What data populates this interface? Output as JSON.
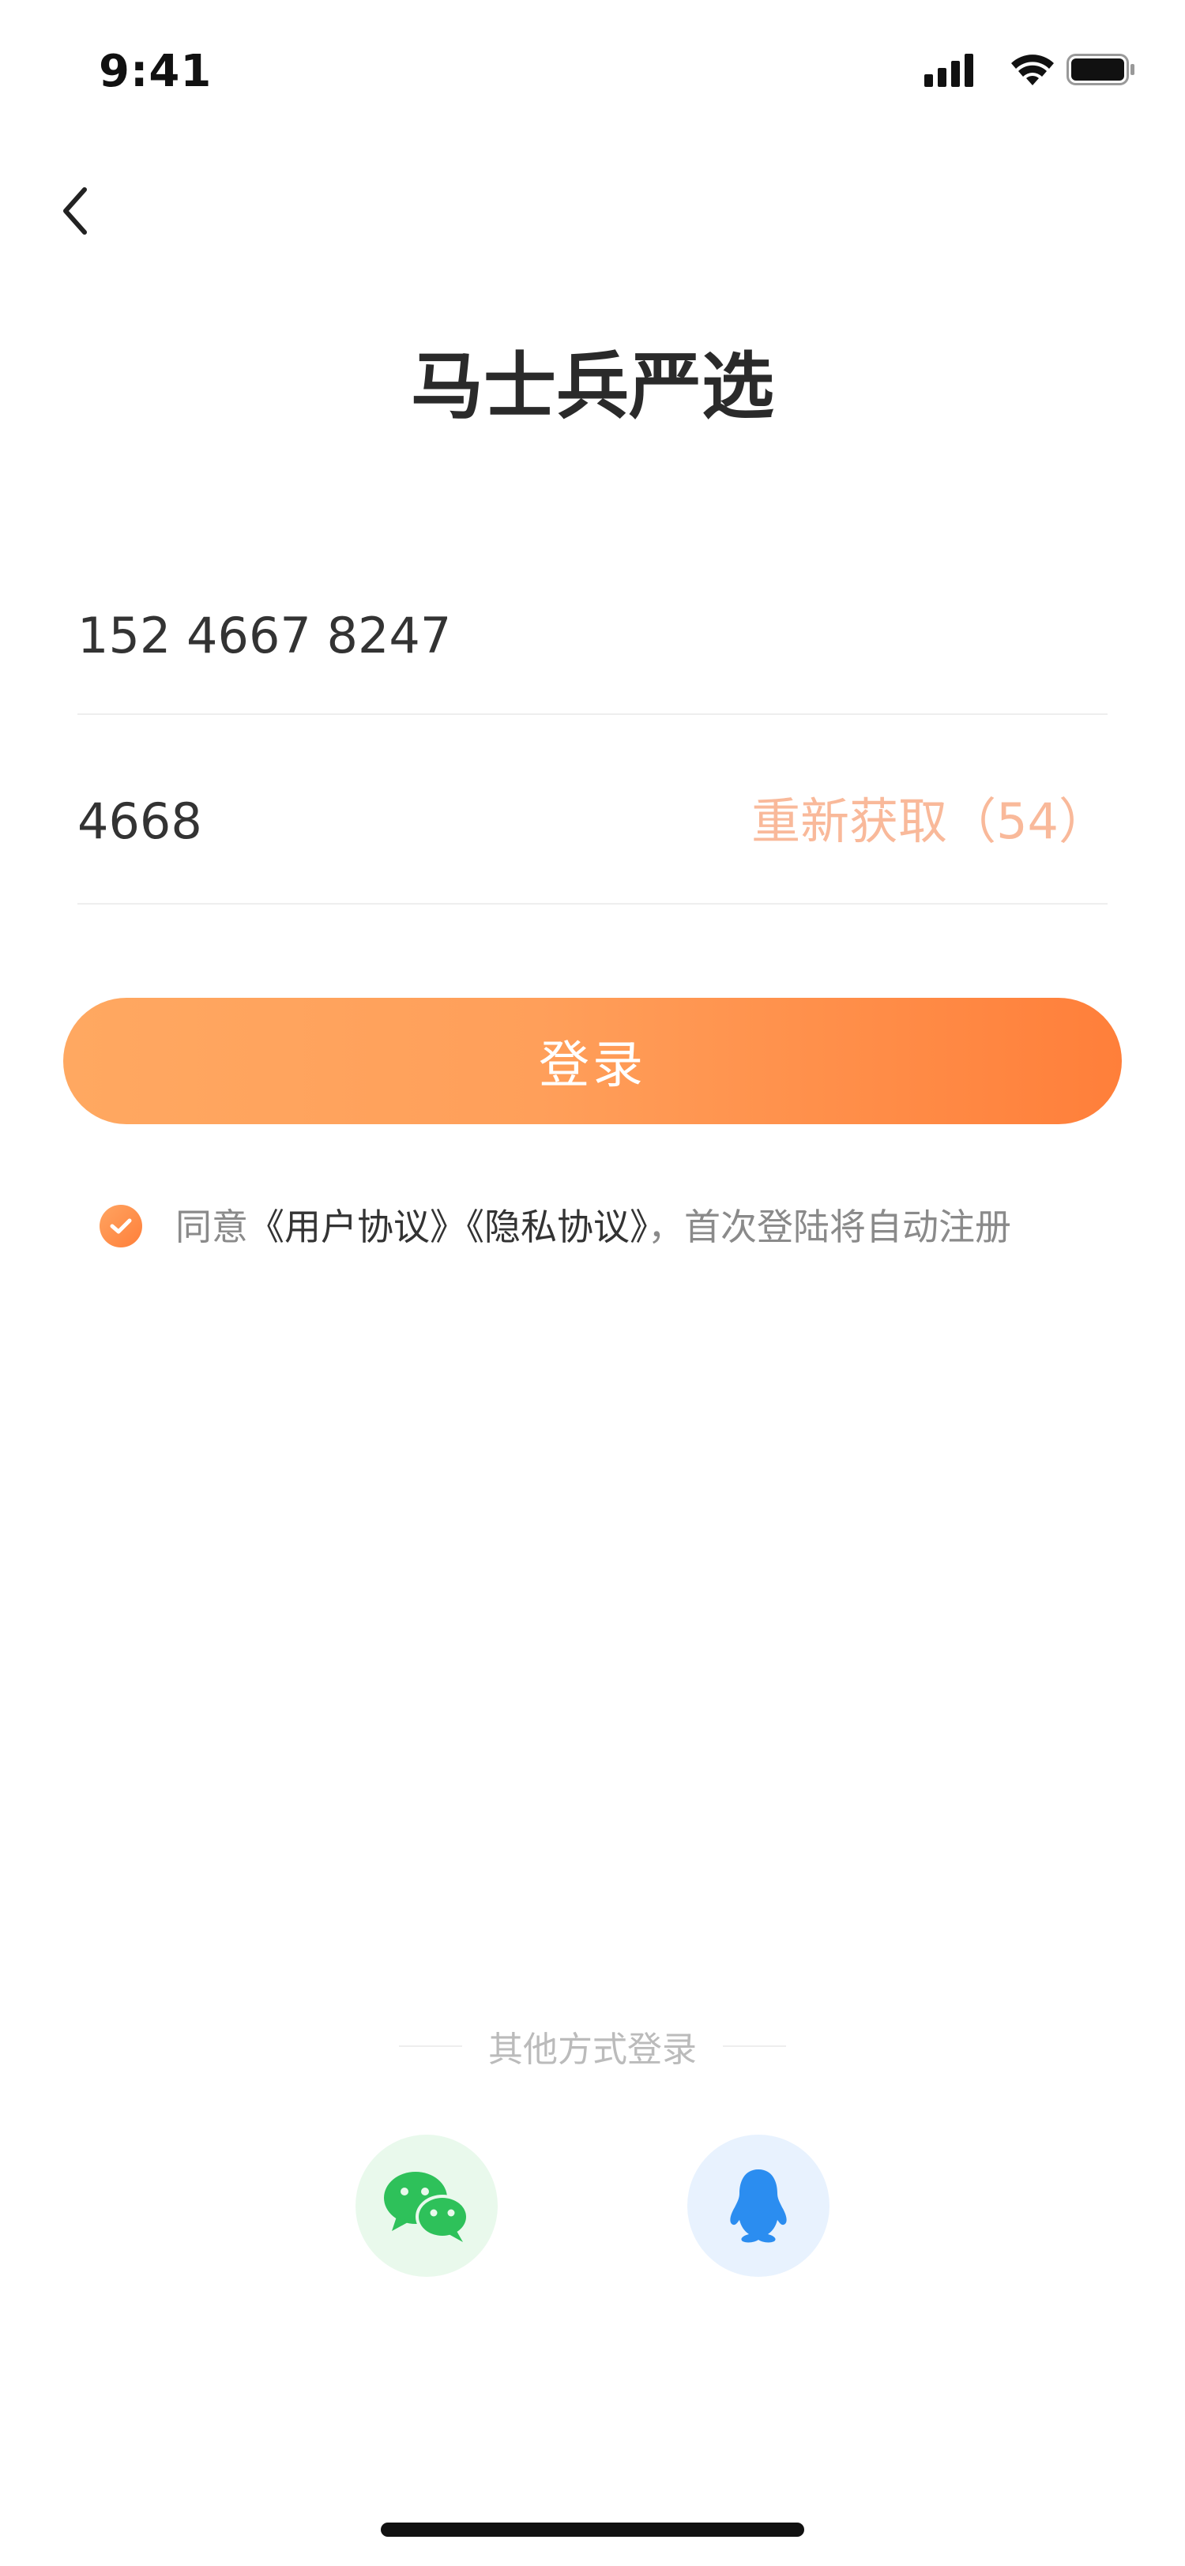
{
  "status_bar": {
    "time": "9:41"
  },
  "header": {
    "title": "马士兵严选"
  },
  "form": {
    "phone_value": "152 4667 8247",
    "code_value": "4668",
    "resend_label": "重新获取（54）"
  },
  "login_button": {
    "label": "登录"
  },
  "agreement": {
    "checked": true,
    "prefix": "同意",
    "user_agreement": "《用户协议》",
    "privacy_agreement": "《隐私协议》",
    "suffix": "，首次登陆将自动注册"
  },
  "other_login": {
    "label": "其他方式登录",
    "methods": [
      {
        "icon": "wechat-icon",
        "color": "#2ec15a"
      },
      {
        "icon": "qq-penguin-icon",
        "color": "#2b8df0"
      }
    ]
  },
  "colors": {
    "accent_start": "#ffa861",
    "accent_end": "#ff7f3a",
    "resend": "#f9b99a"
  }
}
